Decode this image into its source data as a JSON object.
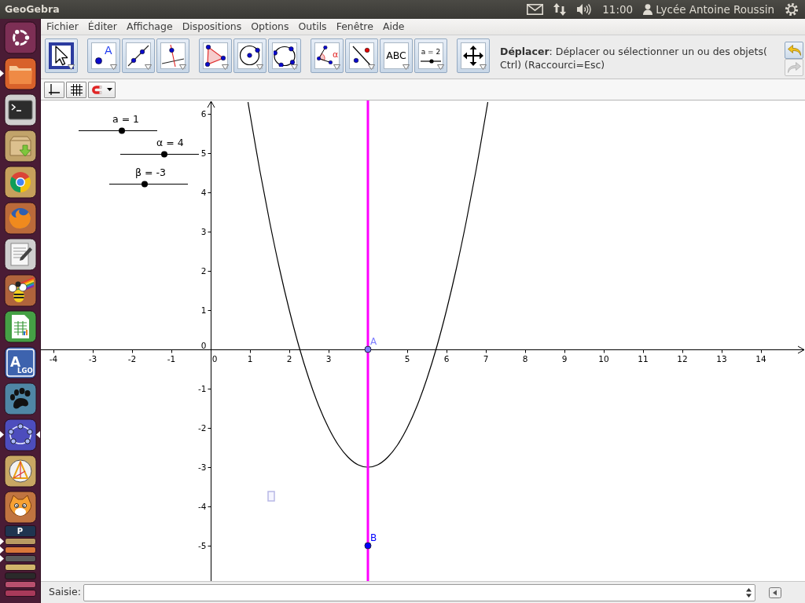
{
  "top_panel": {
    "title": "GeoGebra",
    "clock": "11:00",
    "user": "Lycée Antoine Roussin"
  },
  "launcher": {
    "items": [
      {
        "kind": "dash",
        "running": false,
        "focused": false
      },
      {
        "kind": "folder",
        "running": true,
        "focused": false
      },
      {
        "kind": "terminal",
        "running": false,
        "focused": false
      },
      {
        "kind": "archive",
        "running": false,
        "focused": false
      },
      {
        "kind": "ring",
        "running": false,
        "focused": false
      },
      {
        "kind": "fox",
        "running": false,
        "focused": false
      },
      {
        "kind": "editor",
        "running": false,
        "focused": false
      },
      {
        "kind": "bee",
        "running": false,
        "focused": false
      },
      {
        "kind": "sheet",
        "running": false,
        "focused": false
      },
      {
        "kind": "letters",
        "glyph": "A",
        "caption": "LGO",
        "running": false,
        "focused": false
      },
      {
        "kind": "paw",
        "running": false,
        "focused": false
      },
      {
        "kind": "geometry",
        "running": true,
        "focused": true
      },
      {
        "kind": "compass",
        "running": false,
        "focused": false
      },
      {
        "kind": "cat",
        "running": false,
        "focused": false
      }
    ],
    "stack": [
      {
        "glyph": "P",
        "color": "#1f3550",
        "running": false
      },
      {
        "color": "#b99a62",
        "running": true
      },
      {
        "color": "#d9773a",
        "running": true
      },
      {
        "color": "#5a5a5a",
        "running": true
      },
      {
        "color": "#d2b46a",
        "running": false
      },
      {
        "color": "#2a2a2a",
        "running": false
      },
      {
        "color": "#b8506e",
        "running": false
      },
      {
        "color": "#a83a5a",
        "running": false
      }
    ]
  },
  "menu_bar": [
    "Fichier",
    "Éditer",
    "Affichage",
    "Dispositions",
    "Options",
    "Outils",
    "Fenêtre",
    "Aide"
  ],
  "toolbar": {
    "groups": [
      [
        {
          "kind": "move",
          "selected": true
        }
      ],
      [
        {
          "kind": "point",
          "glyph": "A",
          "selected": false
        },
        {
          "kind": "line",
          "selected": false
        },
        {
          "kind": "perpendicular",
          "selected": false
        }
      ],
      [
        {
          "kind": "polygon",
          "selected": false
        },
        {
          "kind": "circle",
          "selected": false
        },
        {
          "kind": "conic",
          "selected": false
        }
      ],
      [
        {
          "kind": "angle",
          "glyph": "α",
          "selected": false
        },
        {
          "kind": "reflect",
          "selected": false
        },
        {
          "kind": "text",
          "glyph": "ABC",
          "selected": false
        },
        {
          "kind": "slider",
          "glyph": "a = 2",
          "selected": false
        }
      ],
      [
        {
          "kind": "pan",
          "selected": false
        }
      ]
    ],
    "help": "**Déplacer**: Déplacer ou sélectionner un ou des objets( Ctrl) (Raccourci=Esc)",
    "undo": {
      "disabled": false
    },
    "redo": {
      "disabled": true
    }
  },
  "style_bar": [
    {
      "kind": "axes"
    },
    {
      "kind": "grid"
    },
    {
      "kind": "capture"
    }
  ],
  "graphics_view": {
    "sliders": [
      {
        "label": "a = 1",
        "level": 0.55
      },
      {
        "label": "α = 4",
        "level": 0.56
      },
      {
        "label": "β = -3",
        "level": 0.45
      }
    ],
    "chart_data": {
      "type": "line",
      "x": [
        0.95,
        1,
        1.25,
        1.5,
        1.75,
        2,
        2.25,
        2.5,
        2.75,
        3,
        3.25,
        3.5,
        3.75,
        4,
        4.25,
        4.5,
        4.75,
        5,
        5.25,
        5.5,
        5.75,
        6,
        6.25,
        6.5,
        6.75,
        7,
        7.05
      ],
      "series": [
        {
          "color": "#000000",
          "values": [
            6.3,
            6,
            4.56,
            3.25,
            2.06,
            1,
            0.06,
            -0.75,
            -1.44,
            -2,
            -2.44,
            -2.75,
            -2.94,
            -3,
            -2.94,
            -2.75,
            -2.44,
            -2,
            -1.44,
            -0.75,
            0.06,
            1,
            2.06,
            3.25,
            4.56,
            6,
            6.3
          ]
        },
        {
          "name": "A",
          "color": "#7d7dff",
          "marker": "circle",
          "values": [
            null,
            null,
            null,
            null,
            null,
            null,
            null,
            null,
            null,
            null,
            null,
            null,
            null,
            0,
            null,
            null,
            null,
            null,
            null,
            null,
            null,
            null,
            null,
            null,
            null,
            null,
            null
          ]
        },
        {
          "name": "B",
          "color": "#0000ff",
          "marker": "circle",
          "values": [
            null,
            null,
            null,
            null,
            null,
            null,
            null,
            null,
            null,
            null,
            null,
            null,
            null,
            -5,
            null,
            null,
            null,
            null,
            null,
            null,
            null,
            null,
            null,
            null,
            null,
            null,
            null
          ]
        }
      ],
      "xlim": [
        -4.32,
        15.12
      ],
      "ylim": [
        -5.9,
        6.34
      ],
      "xticks": [
        -4,
        -3,
        -2,
        -1,
        0,
        1,
        2,
        3,
        5,
        6,
        7,
        8,
        9,
        10,
        11,
        12,
        13,
        14
      ],
      "yticks": [
        -5,
        -4,
        -3,
        -2,
        -1,
        0,
        1,
        2,
        3,
        4,
        5,
        6
      ],
      "ref_lines": [
        {
          "axis": "x",
          "value": 4,
          "color": "#ff00ff"
        }
      ]
    }
  },
  "input_bar": {
    "label": "Saisie:"
  }
}
